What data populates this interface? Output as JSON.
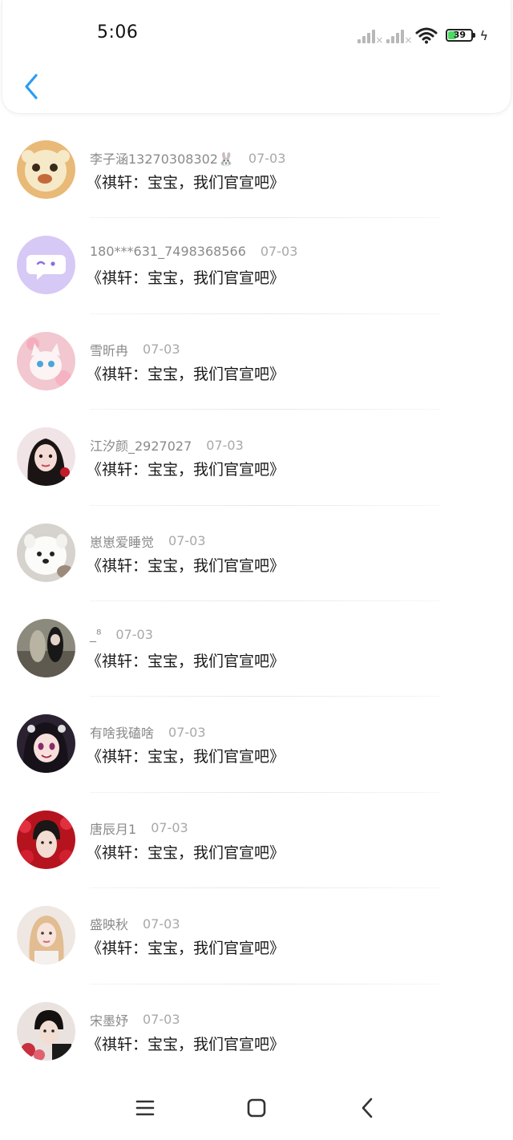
{
  "status_bar": {
    "time": "5:06",
    "battery_level": "39",
    "battery_color": "#4cd964"
  },
  "header": {
    "back_icon": "chevron-left-icon",
    "accent_color": "#2a9df4"
  },
  "comments": [
    {
      "username": "李子涵13270308302🐰",
      "date": "07-03",
      "text": "《祺轩：宝宝，我们官宣吧》",
      "avatar_icon": "sheep-cartoon-avatar"
    },
    {
      "username": "180***631_7498368566",
      "date": "07-03",
      "text": "《祺轩：宝宝，我们官宣吧》",
      "avatar_icon": "chat-bubble-avatar"
    },
    {
      "username": "雪昕冉",
      "date": "07-03",
      "text": "《祺轩：宝宝，我们官宣吧》",
      "avatar_icon": "white-cat-avatar"
    },
    {
      "username": "江汐颜_2927027",
      "date": "07-03",
      "text": "《祺轩：宝宝，我们官宣吧》",
      "avatar_icon": "girl-portrait-avatar"
    },
    {
      "username": "崽崽爱睡觉",
      "date": "07-03",
      "text": "《祺轩：宝宝，我们官宣吧》",
      "avatar_icon": "white-dog-avatar"
    },
    {
      "username": "_⁸",
      "date": "07-03",
      "text": "《祺轩：宝宝，我们官宣吧》",
      "avatar_icon": "couple-photo-avatar"
    },
    {
      "username": "有啥我磕啥",
      "date": "07-03",
      "text": "《祺轩：宝宝，我们官宣吧》",
      "avatar_icon": "anime-girl-avatar"
    },
    {
      "username": "唐辰月1",
      "date": "07-03",
      "text": "《祺轩：宝宝，我们官宣吧》",
      "avatar_icon": "boy-roses-avatar"
    },
    {
      "username": "盛映秋",
      "date": "07-03",
      "text": "《祺轩：宝宝，我们官宣吧》",
      "avatar_icon": "blonde-girl-avatar"
    },
    {
      "username": "宋墨妤",
      "date": "07-03",
      "text": "《祺轩：宝宝，我们官宣吧》",
      "avatar_icon": "boy-flowers-avatar"
    }
  ],
  "nav_bar": {
    "menu_icon": "menu-icon",
    "home_icon": "home-square-icon",
    "back_icon": "back-triangle-icon"
  }
}
